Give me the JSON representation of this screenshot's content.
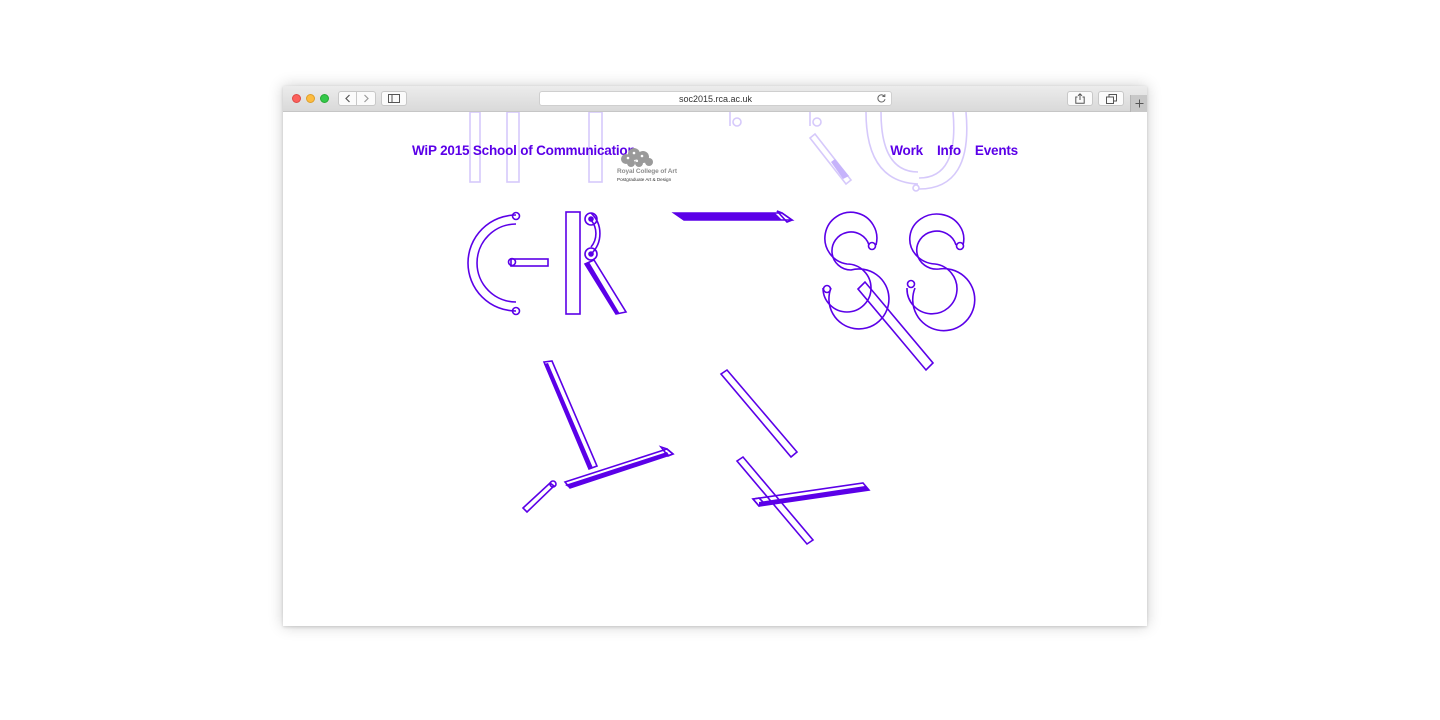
{
  "browser": {
    "url": "soc2015.rca.ac.uk",
    "icons": {
      "back": "chevron-left-icon",
      "forward": "chevron-right-icon",
      "sidebar": "sidebar-icon",
      "reload": "reload-icon",
      "share": "share-icon",
      "tabs": "tabs-icon",
      "new_tab": "plus-icon"
    }
  },
  "site": {
    "title": "WiP 2015 School of Communication",
    "nav": [
      "Work",
      "Info",
      "Events"
    ],
    "logo": {
      "name": "Royal College of Art",
      "subtitle": "Postgraduate Art & Design"
    }
  },
  "colors": {
    "accent": "#5b00e8",
    "accent_faded": "#d6c9fb",
    "logo_grey": "#8d8d8d"
  }
}
